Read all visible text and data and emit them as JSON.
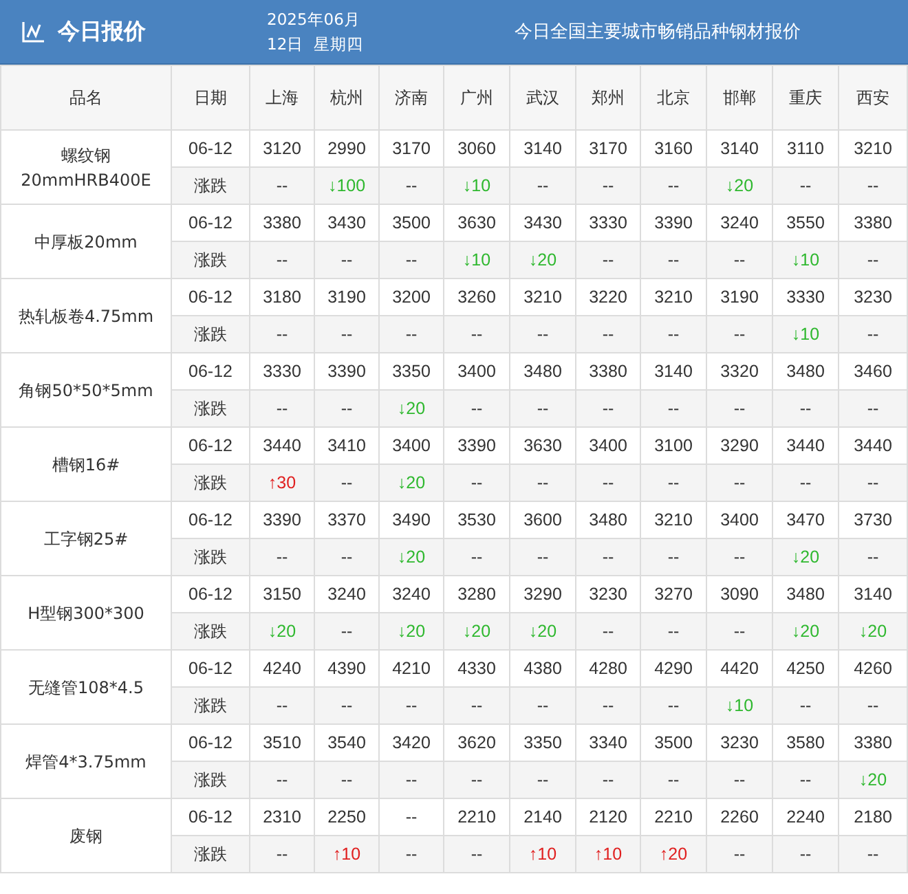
{
  "header": {
    "title": "今日报价",
    "date_line_1": "2025年06月",
    "date_line_2": "12日  星期四",
    "subtitle": "今日全国主要城市畅销品种钢材报价"
  },
  "columns": [
    "品名",
    "日期",
    "上海",
    "杭州",
    "济南",
    "广州",
    "武汉",
    "郑州",
    "北京",
    "邯郸",
    "重庆",
    "西安"
  ],
  "products": [
    {
      "name_lines": [
        "螺纹钢",
        "20mmHRB400E"
      ],
      "date": "06-12",
      "change_label": "涨跌",
      "prices": [
        "3120",
        "2990",
        "3170",
        "3060",
        "3140",
        "3170",
        "3160",
        "3140",
        "3110",
        "3210"
      ],
      "changes": [
        {
          "text": "--",
          "kind": "flat"
        },
        {
          "text": "↓100",
          "kind": "down"
        },
        {
          "text": "--",
          "kind": "flat"
        },
        {
          "text": "↓10",
          "kind": "down"
        },
        {
          "text": "--",
          "kind": "flat"
        },
        {
          "text": "--",
          "kind": "flat"
        },
        {
          "text": "--",
          "kind": "flat"
        },
        {
          "text": "↓20",
          "kind": "down"
        },
        {
          "text": "--",
          "kind": "flat"
        },
        {
          "text": "--",
          "kind": "flat"
        }
      ]
    },
    {
      "name_lines": [
        "中厚板20mm"
      ],
      "date": "06-12",
      "change_label": "涨跌",
      "prices": [
        "3380",
        "3430",
        "3500",
        "3630",
        "3430",
        "3330",
        "3390",
        "3240",
        "3550",
        "3380"
      ],
      "changes": [
        {
          "text": "--",
          "kind": "flat"
        },
        {
          "text": "--",
          "kind": "flat"
        },
        {
          "text": "--",
          "kind": "flat"
        },
        {
          "text": "↓10",
          "kind": "down"
        },
        {
          "text": "↓20",
          "kind": "down"
        },
        {
          "text": "--",
          "kind": "flat"
        },
        {
          "text": "--",
          "kind": "flat"
        },
        {
          "text": "--",
          "kind": "flat"
        },
        {
          "text": "↓10",
          "kind": "down"
        },
        {
          "text": "--",
          "kind": "flat"
        }
      ]
    },
    {
      "name_lines": [
        "热轧板卷4.75mm"
      ],
      "date": "06-12",
      "change_label": "涨跌",
      "prices": [
        "3180",
        "3190",
        "3200",
        "3260",
        "3210",
        "3220",
        "3210",
        "3190",
        "3330",
        "3230"
      ],
      "changes": [
        {
          "text": "--",
          "kind": "flat"
        },
        {
          "text": "--",
          "kind": "flat"
        },
        {
          "text": "--",
          "kind": "flat"
        },
        {
          "text": "--",
          "kind": "flat"
        },
        {
          "text": "--",
          "kind": "flat"
        },
        {
          "text": "--",
          "kind": "flat"
        },
        {
          "text": "--",
          "kind": "flat"
        },
        {
          "text": "--",
          "kind": "flat"
        },
        {
          "text": "↓10",
          "kind": "down"
        },
        {
          "text": "--",
          "kind": "flat"
        }
      ]
    },
    {
      "name_lines": [
        "角钢50*50*5mm"
      ],
      "date": "06-12",
      "change_label": "涨跌",
      "prices": [
        "3330",
        "3390",
        "3350",
        "3400",
        "3480",
        "3380",
        "3140",
        "3320",
        "3480",
        "3460"
      ],
      "changes": [
        {
          "text": "--",
          "kind": "flat"
        },
        {
          "text": "--",
          "kind": "flat"
        },
        {
          "text": "↓20",
          "kind": "down"
        },
        {
          "text": "--",
          "kind": "flat"
        },
        {
          "text": "--",
          "kind": "flat"
        },
        {
          "text": "--",
          "kind": "flat"
        },
        {
          "text": "--",
          "kind": "flat"
        },
        {
          "text": "--",
          "kind": "flat"
        },
        {
          "text": "--",
          "kind": "flat"
        },
        {
          "text": "--",
          "kind": "flat"
        }
      ]
    },
    {
      "name_lines": [
        "槽钢16#"
      ],
      "date": "06-12",
      "change_label": "涨跌",
      "prices": [
        "3440",
        "3410",
        "3400",
        "3390",
        "3630",
        "3400",
        "3100",
        "3290",
        "3440",
        "3440"
      ],
      "changes": [
        {
          "text": "↑30",
          "kind": "up"
        },
        {
          "text": "--",
          "kind": "flat"
        },
        {
          "text": "↓20",
          "kind": "down"
        },
        {
          "text": "--",
          "kind": "flat"
        },
        {
          "text": "--",
          "kind": "flat"
        },
        {
          "text": "--",
          "kind": "flat"
        },
        {
          "text": "--",
          "kind": "flat"
        },
        {
          "text": "--",
          "kind": "flat"
        },
        {
          "text": "--",
          "kind": "flat"
        },
        {
          "text": "--",
          "kind": "flat"
        }
      ]
    },
    {
      "name_lines": [
        "工字钢25#"
      ],
      "date": "06-12",
      "change_label": "涨跌",
      "prices": [
        "3390",
        "3370",
        "3490",
        "3530",
        "3600",
        "3480",
        "3210",
        "3400",
        "3470",
        "3730"
      ],
      "changes": [
        {
          "text": "--",
          "kind": "flat"
        },
        {
          "text": "--",
          "kind": "flat"
        },
        {
          "text": "↓20",
          "kind": "down"
        },
        {
          "text": "--",
          "kind": "flat"
        },
        {
          "text": "--",
          "kind": "flat"
        },
        {
          "text": "--",
          "kind": "flat"
        },
        {
          "text": "--",
          "kind": "flat"
        },
        {
          "text": "--",
          "kind": "flat"
        },
        {
          "text": "↓20",
          "kind": "down"
        },
        {
          "text": "--",
          "kind": "flat"
        }
      ]
    },
    {
      "name_lines": [
        "H型钢300*300"
      ],
      "date": "06-12",
      "change_label": "涨跌",
      "prices": [
        "3150",
        "3240",
        "3240",
        "3280",
        "3290",
        "3230",
        "3270",
        "3090",
        "3480",
        "3140"
      ],
      "changes": [
        {
          "text": "↓20",
          "kind": "down"
        },
        {
          "text": "--",
          "kind": "flat"
        },
        {
          "text": "↓20",
          "kind": "down"
        },
        {
          "text": "↓20",
          "kind": "down"
        },
        {
          "text": "↓20",
          "kind": "down"
        },
        {
          "text": "--",
          "kind": "flat"
        },
        {
          "text": "--",
          "kind": "flat"
        },
        {
          "text": "--",
          "kind": "flat"
        },
        {
          "text": "↓20",
          "kind": "down"
        },
        {
          "text": "↓20",
          "kind": "down"
        }
      ]
    },
    {
      "name_lines": [
        "无缝管108*4.5"
      ],
      "date": "06-12",
      "change_label": "涨跌",
      "prices": [
        "4240",
        "4390",
        "4210",
        "4330",
        "4380",
        "4280",
        "4290",
        "4420",
        "4250",
        "4260"
      ],
      "changes": [
        {
          "text": "--",
          "kind": "flat"
        },
        {
          "text": "--",
          "kind": "flat"
        },
        {
          "text": "--",
          "kind": "flat"
        },
        {
          "text": "--",
          "kind": "flat"
        },
        {
          "text": "--",
          "kind": "flat"
        },
        {
          "text": "--",
          "kind": "flat"
        },
        {
          "text": "--",
          "kind": "flat"
        },
        {
          "text": "↓10",
          "kind": "down"
        },
        {
          "text": "--",
          "kind": "flat"
        },
        {
          "text": "--",
          "kind": "flat"
        }
      ]
    },
    {
      "name_lines": [
        "焊管4*3.75mm"
      ],
      "date": "06-12",
      "change_label": "涨跌",
      "prices": [
        "3510",
        "3540",
        "3420",
        "3620",
        "3350",
        "3340",
        "3500",
        "3230",
        "3580",
        "3380"
      ],
      "changes": [
        {
          "text": "--",
          "kind": "flat"
        },
        {
          "text": "--",
          "kind": "flat"
        },
        {
          "text": "--",
          "kind": "flat"
        },
        {
          "text": "--",
          "kind": "flat"
        },
        {
          "text": "--",
          "kind": "flat"
        },
        {
          "text": "--",
          "kind": "flat"
        },
        {
          "text": "--",
          "kind": "flat"
        },
        {
          "text": "--",
          "kind": "flat"
        },
        {
          "text": "--",
          "kind": "flat"
        },
        {
          "text": "↓20",
          "kind": "down"
        }
      ]
    },
    {
      "name_lines": [
        "废钢"
      ],
      "date": "06-12",
      "change_label": "涨跌",
      "prices": [
        "2310",
        "2250",
        "--",
        "2210",
        "2140",
        "2120",
        "2210",
        "2260",
        "2240",
        "2180"
      ],
      "changes": [
        {
          "text": "--",
          "kind": "flat"
        },
        {
          "text": "↑10",
          "kind": "up"
        },
        {
          "text": "--",
          "kind": "flat"
        },
        {
          "text": "--",
          "kind": "flat"
        },
        {
          "text": "↑10",
          "kind": "up"
        },
        {
          "text": "↑10",
          "kind": "up"
        },
        {
          "text": "↑20",
          "kind": "up"
        },
        {
          "text": "--",
          "kind": "flat"
        },
        {
          "text": "--",
          "kind": "flat"
        },
        {
          "text": "--",
          "kind": "flat"
        }
      ]
    }
  ]
}
